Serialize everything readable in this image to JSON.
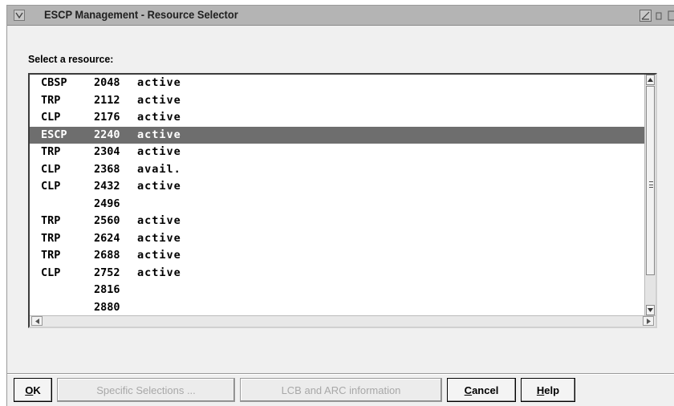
{
  "window": {
    "title": "ESCP Management - Resource Selector"
  },
  "prompt": "Select a resource:",
  "resources": [
    {
      "type": "CBSP",
      "number": "2048",
      "status": "active"
    },
    {
      "type": "TRP",
      "number": "2112",
      "status": "active"
    },
    {
      "type": "CLP",
      "number": "2176",
      "status": "active"
    },
    {
      "type": "ESCP",
      "number": "2240",
      "status": "active",
      "selected": true
    },
    {
      "type": "TRP",
      "number": "2304",
      "status": "active"
    },
    {
      "type": "CLP",
      "number": "2368",
      "status": "avail."
    },
    {
      "type": "CLP",
      "number": "2432",
      "status": "active"
    },
    {
      "type": "",
      "number": "2496",
      "status": ""
    },
    {
      "type": "TRP",
      "number": "2560",
      "status": "active"
    },
    {
      "type": "TRP",
      "number": "2624",
      "status": "active"
    },
    {
      "type": "TRP",
      "number": "2688",
      "status": "active"
    },
    {
      "type": "CLP",
      "number": "2752",
      "status": "active"
    },
    {
      "type": "",
      "number": "2816",
      "status": ""
    },
    {
      "type": "",
      "number": "2880",
      "status": ""
    }
  ],
  "buttons": {
    "ok": "OK",
    "specific_selections": "Specific Selections ...",
    "lcb_arc": "LCB and ARC information",
    "cancel": "Cancel",
    "help": "Help"
  },
  "colors": {
    "selection": "#6e6e6e",
    "titlebar": "#b4b4b4"
  }
}
